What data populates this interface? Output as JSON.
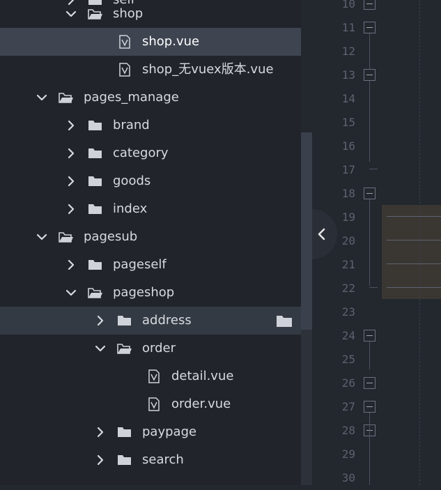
{
  "sidebar": {
    "items": [
      {
        "label": "self",
        "type": "folder",
        "expanded": false
      },
      {
        "label": "shop",
        "type": "folder",
        "expanded": true
      },
      {
        "label": "shop.vue",
        "type": "file",
        "selected": true
      },
      {
        "label": "shop_无vuex版本.vue",
        "type": "file"
      },
      {
        "label": "pages_manage",
        "type": "folder",
        "expanded": true
      },
      {
        "label": "brand",
        "type": "folder",
        "expanded": false
      },
      {
        "label": "category",
        "type": "folder",
        "expanded": false
      },
      {
        "label": "goods",
        "type": "folder",
        "expanded": false
      },
      {
        "label": "index",
        "type": "folder",
        "expanded": false
      },
      {
        "label": "pagesub",
        "type": "folder",
        "expanded": true
      },
      {
        "label": "pageself",
        "type": "folder",
        "expanded": false
      },
      {
        "label": "pageshop",
        "type": "folder",
        "expanded": true
      },
      {
        "label": "address",
        "type": "folder",
        "expanded": false,
        "hovered": true
      },
      {
        "label": "order",
        "type": "folder",
        "expanded": true
      },
      {
        "label": "detail.vue",
        "type": "file"
      },
      {
        "label": "order.vue",
        "type": "file"
      },
      {
        "label": "paypage",
        "type": "folder",
        "expanded": false
      },
      {
        "label": "search",
        "type": "folder",
        "expanded": false
      }
    ]
  },
  "gutter": {
    "line_numbers": [
      "10",
      "11",
      "12",
      "13",
      "14",
      "15",
      "16",
      "17",
      "18",
      "19",
      "20",
      "21",
      "22",
      "23",
      "24",
      "25",
      "26",
      "27",
      "28",
      "29",
      "30"
    ]
  },
  "colors": {
    "sidebar_bg": "#21252b",
    "selected_bg": "#3e4450",
    "editor_bg": "#23272e",
    "text": "#d7dae0",
    "line_number": "#5c6370",
    "highlight": "#3a3733"
  },
  "icons": {
    "folder_open": "folder-open-icon",
    "folder_closed": "folder-icon",
    "file": "vue-file-icon",
    "chevron_right": "chevron-right-icon",
    "chevron_down": "chevron-down-icon",
    "collapse": "chevron-left-icon"
  }
}
